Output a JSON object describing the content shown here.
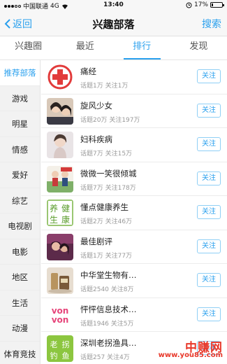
{
  "status": {
    "carrier": "中国联通",
    "network": "4G",
    "time": "13:40",
    "battery_text": "17%",
    "battery_level": 0.17
  },
  "nav": {
    "back_label": "返回",
    "title": "兴趣部落",
    "search_label": "搜索"
  },
  "tabs": [
    {
      "label": "兴趣圈"
    },
    {
      "label": "最近"
    },
    {
      "label": "排行"
    },
    {
      "label": "发现"
    }
  ],
  "active_tab": "排行",
  "sidebar": {
    "items": [
      {
        "label": "推荐部落"
      },
      {
        "label": "游戏"
      },
      {
        "label": "明星"
      },
      {
        "label": "情感"
      },
      {
        "label": "爱好"
      },
      {
        "label": "综艺"
      },
      {
        "label": "电视剧"
      },
      {
        "label": "电影"
      },
      {
        "label": "地区"
      },
      {
        "label": "生活"
      },
      {
        "label": "动漫"
      },
      {
        "label": "体育竞技"
      }
    ],
    "active": "推荐部落"
  },
  "list": {
    "follow_label": "关注",
    "items": [
      {
        "name": "痛经",
        "meta": "话题1万 关注1万",
        "icon": "red-cross-logo-icon"
      },
      {
        "name": "旋风少女",
        "meta": "话题20万 关注197万",
        "icon": "drama-poster-thumbnail"
      },
      {
        "name": "妇科疾病",
        "meta": "话题7万 关注15万",
        "icon": "woman-portrait-thumbnail"
      },
      {
        "name": "微微一笑很倾城",
        "meta": "话题7万 关注178万",
        "icon": "drama-poster-thumbnail"
      },
      {
        "name": "懂点健康养生",
        "meta": "话题2万 关注46万",
        "icon": "health-calligraphy-logo-icon",
        "logo_text": "养健生康"
      },
      {
        "name": "最佳剧评",
        "meta": "话题1万 关注77万",
        "icon": "movie-still-thumbnail"
      },
      {
        "name": "中华堂生物有…",
        "meta": "话题2540 关注8万",
        "icon": "product-photo-thumbnail"
      },
      {
        "name": "怦怦信息技术…",
        "meta": "话题1946 关注5万",
        "icon": "vonvon-logo-icon",
        "logo_text": [
          "von",
          "von"
        ]
      },
      {
        "name": "深圳老拐渔具…",
        "meta": "话题257 关注4万",
        "icon": "fishing-calligraphy-logo-icon",
        "logo_text": "老拐钓鱼"
      }
    ]
  },
  "watermark": {
    "line1": "中赚网",
    "line2": "www.you85.com"
  },
  "colors": {
    "accent": "#2aa0ee",
    "watermark": "#e8382a",
    "sidebar_bg": "#f2f2f2"
  }
}
